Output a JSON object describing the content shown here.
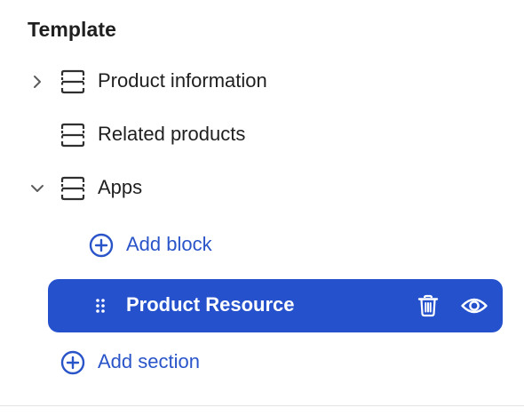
{
  "panel": {
    "heading": "Template",
    "items": [
      {
        "label": "Product information",
        "expanded": false,
        "icon": "section-icon"
      },
      {
        "label": "Related products",
        "icon": "section-icon"
      },
      {
        "label": "Apps",
        "expanded": true,
        "icon": "section-icon"
      }
    ],
    "add_block_label": "Add block",
    "selected_block": {
      "label": "Product Resource",
      "icons": [
        "drag-handle-icon",
        "trash-icon",
        "eye-icon"
      ]
    },
    "add_section_label": "Add section"
  },
  "colors": {
    "accent": "#2551cd",
    "link": "#2a55c9",
    "text": "#1f1f1f"
  }
}
